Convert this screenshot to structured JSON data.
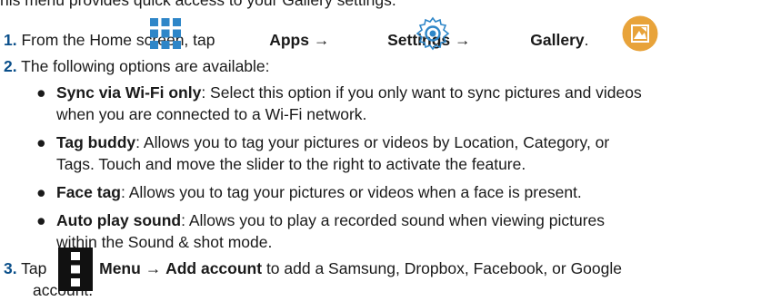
{
  "intro": "his menu provides quick access to your Gallery settings.",
  "step1": {
    "num": "1.",
    "text_a": "From the Home screen, tap",
    "apps": "Apps",
    "arrow1": "→",
    "settings": "Settings",
    "arrow2": "→",
    "gallery": "Gallery",
    "period": "."
  },
  "step2": {
    "num": "2.",
    "text": "The following options are available:"
  },
  "bullets": [
    {
      "term": "Sync via Wi-Fi only",
      "line1": ": Select this option if you only want to sync pictures and videos",
      "line2": "when you are connected to a Wi-Fi network."
    },
    {
      "term": "Tag buddy",
      "line1": ": Allows you to tag your pictures or videos by Location, Category, or",
      "line2": "Tags. Touch and move the slider to the right to activate the feature."
    },
    {
      "term": "Face tag",
      "line1": ": Allows you to tag your pictures or videos when a face is present."
    },
    {
      "term": "Auto play sound",
      "line1": ": Allows you to play a recorded sound when viewing pictures",
      "line2": "within the Sound & shot mode."
    }
  ],
  "step3": {
    "num": "3.",
    "tap": "Tap",
    "menu": "Menu",
    "arrow": "→",
    "add_account": "Add account",
    "text_a": "to add a Samsung, Dropbox, Facebook, or Google",
    "text_b": "account."
  },
  "icons": {
    "apps": "apps-grid-icon",
    "settings": "settings-gear-icon",
    "gallery": "gallery-icon",
    "menu": "menu-overflow-icon"
  },
  "colors": {
    "step_number": "#0a4f8a",
    "apps_icon": "#2e86c8",
    "settings_icon": "#2e86c8",
    "gallery_icon": "#e8a33a"
  }
}
